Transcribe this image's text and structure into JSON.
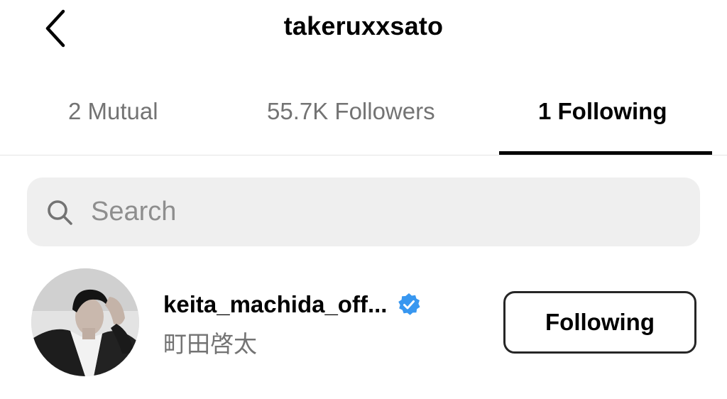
{
  "header": {
    "back_icon": "chevron-left-icon",
    "title": "takeruxxsato"
  },
  "tabs": [
    {
      "label": "2 Mutual",
      "active": false
    },
    {
      "label": "55.7K Followers",
      "active": false
    },
    {
      "label": "1 Following",
      "active": true
    }
  ],
  "search": {
    "icon": "search-icon",
    "placeholder": "Search",
    "value": ""
  },
  "following_list": [
    {
      "username": "keita_machida_off...",
      "verified": true,
      "full_name": "町田啓太",
      "button_label": "Following",
      "avatar_icon": "profile-photo"
    }
  ],
  "colors": {
    "text_primary": "#000000",
    "text_secondary": "#737373",
    "search_bg": "#efefef",
    "verified_badge": "#3897f0",
    "divider": "#e4e4e4"
  }
}
